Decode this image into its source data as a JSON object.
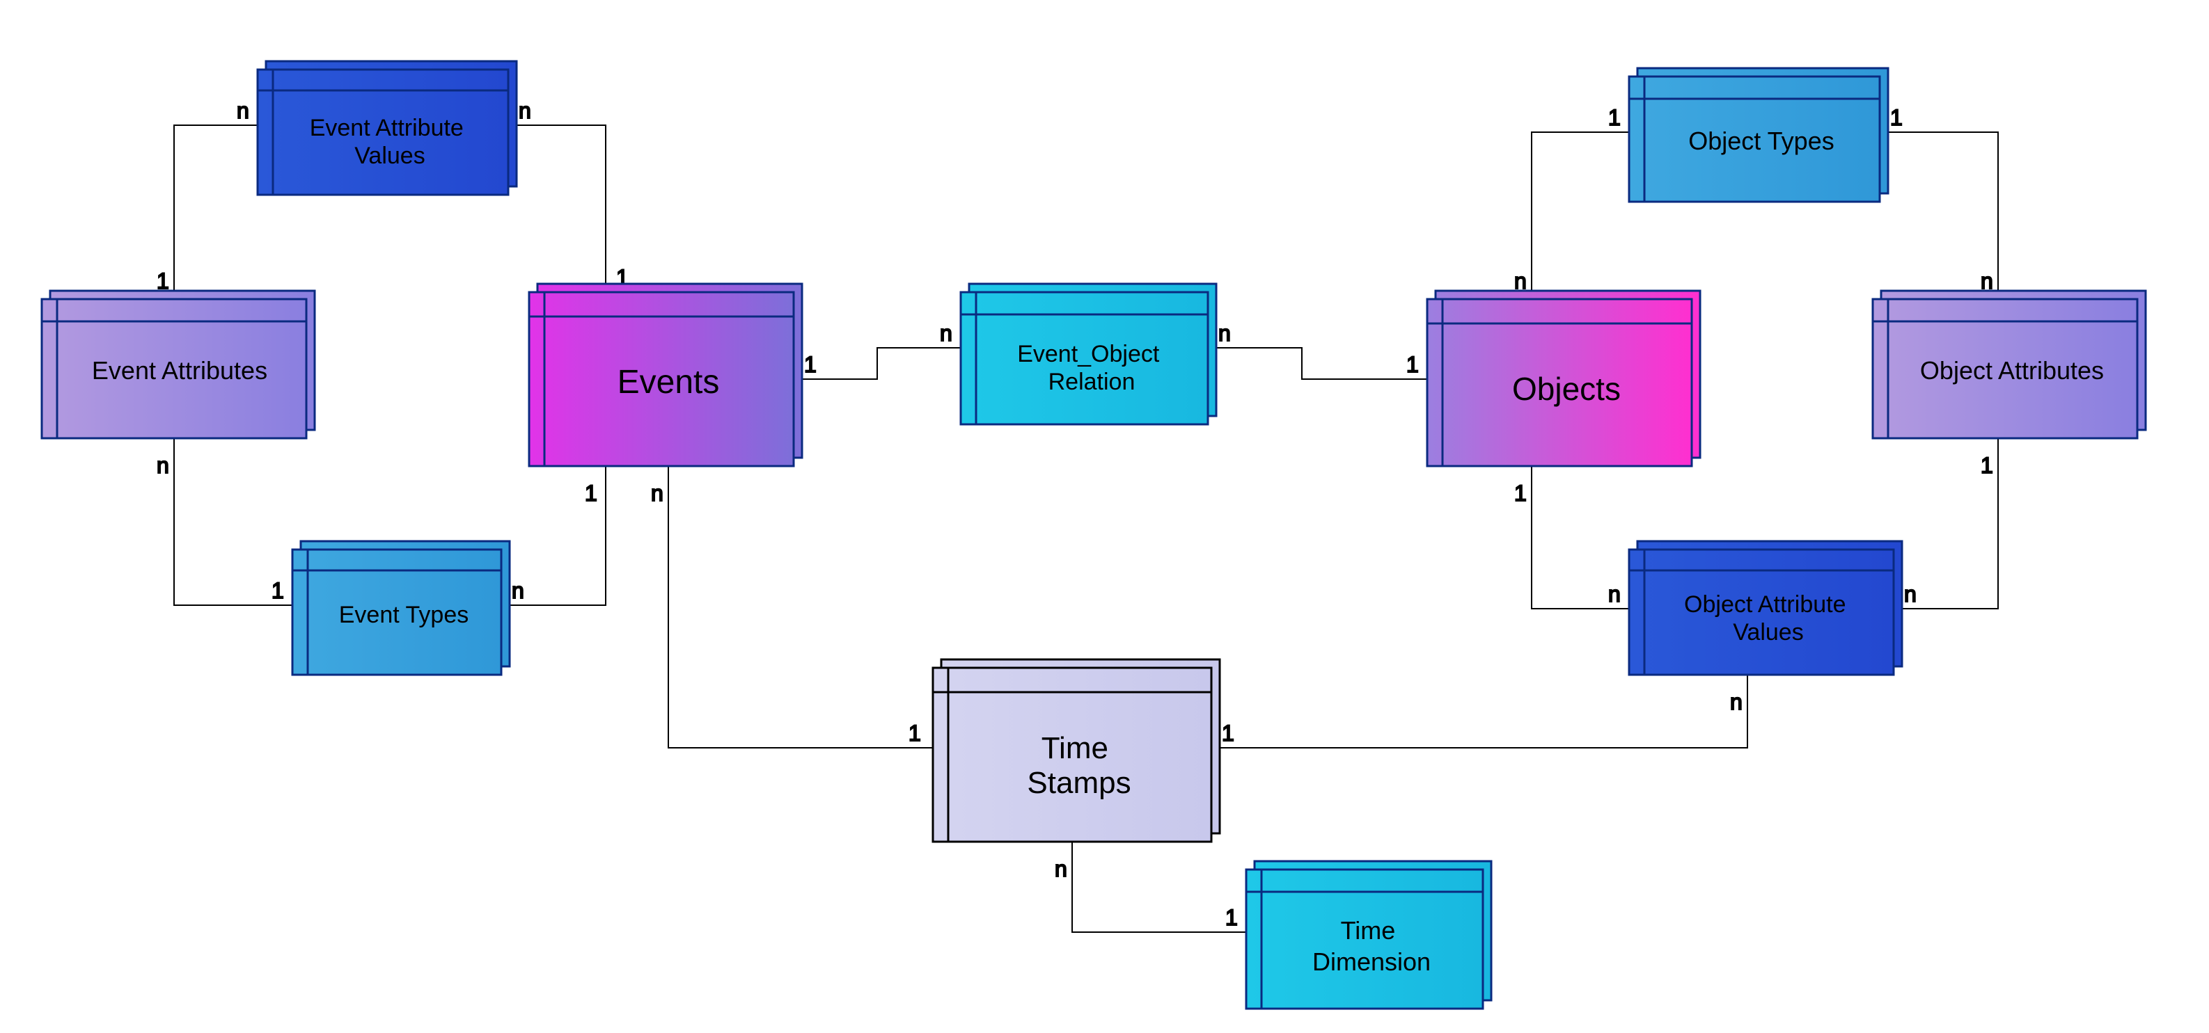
{
  "entities": {
    "event_attr_values": {
      "label": "Event Attribute Values"
    },
    "event_attributes": {
      "label": "Event Attributes"
    },
    "events": {
      "label": "Events"
    },
    "event_types": {
      "label": "Event Types"
    },
    "event_object_rel": {
      "label": "Event_Object Relation"
    },
    "objects": {
      "label": "Objects"
    },
    "object_types": {
      "label": "Object Types"
    },
    "object_attributes": {
      "label": "Object Attributes"
    },
    "object_attr_values": {
      "label": "Object Attribute Values"
    },
    "time_stamps": {
      "label": "Time Stamps"
    },
    "time_dimension": {
      "label": "Time Dimension"
    }
  },
  "relations": {
    "evattr_to_evattrval": {
      "left": "1",
      "right": "n"
    },
    "evattr_to_evtypes": {
      "left": "n",
      "right": "1"
    },
    "evattrval_to_events": {
      "left": "n",
      "right": "1"
    },
    "evtypes_to_events": {
      "left": "1",
      "right": "n"
    },
    "events_to_eorel": {
      "left": "1",
      "right": "n"
    },
    "eorel_to_objects": {
      "left": "n",
      "right": "1"
    },
    "events_to_timestamps": {
      "left": "n",
      "right": "1"
    },
    "objects_to_objtypes_left": {
      "left": "n",
      "right": "1"
    },
    "objtypes_to_objattr": {
      "left": "1",
      "right": "n"
    },
    "objattr_to_objattrval": {
      "left": "1",
      "right": "n"
    },
    "objects_to_objattrval": {
      "left": "1",
      "right": "n"
    },
    "timestamps_to_objattrval": {
      "left": "1",
      "right": "n"
    },
    "timestamps_to_timedim": {
      "left": "n",
      "right": "1"
    }
  }
}
